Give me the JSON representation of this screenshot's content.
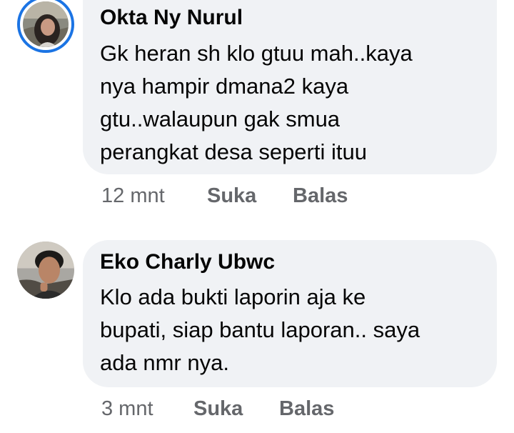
{
  "comments": [
    {
      "author": "Okta Ny Nurul",
      "avatar_icon": "profile-photo-avatar",
      "text_lines": [
        "Gk heran sh klo gtuu mah..kaya",
        "nya hampir dmana2 kaya",
        "gtu..walaupun gak smua",
        "perangkat desa seperti ituu"
      ],
      "time": "12 mnt",
      "like_label": "Suka",
      "reply_label": "Balas"
    },
    {
      "author": "Eko Charly Ubwc",
      "avatar_icon": "profile-photo-avatar",
      "text_lines": [
        "Klo ada bukti laporin aja ke",
        "bupati, siap bantu laporan.. saya",
        "ada nmr nya."
      ],
      "time": "3 mnt",
      "like_label": "Suka",
      "reply_label": "Balas"
    }
  ],
  "colors": {
    "bubble": "#f0f2f5",
    "text": "#050505",
    "meta": "#65676b",
    "story_ring": "#1b74e4"
  }
}
